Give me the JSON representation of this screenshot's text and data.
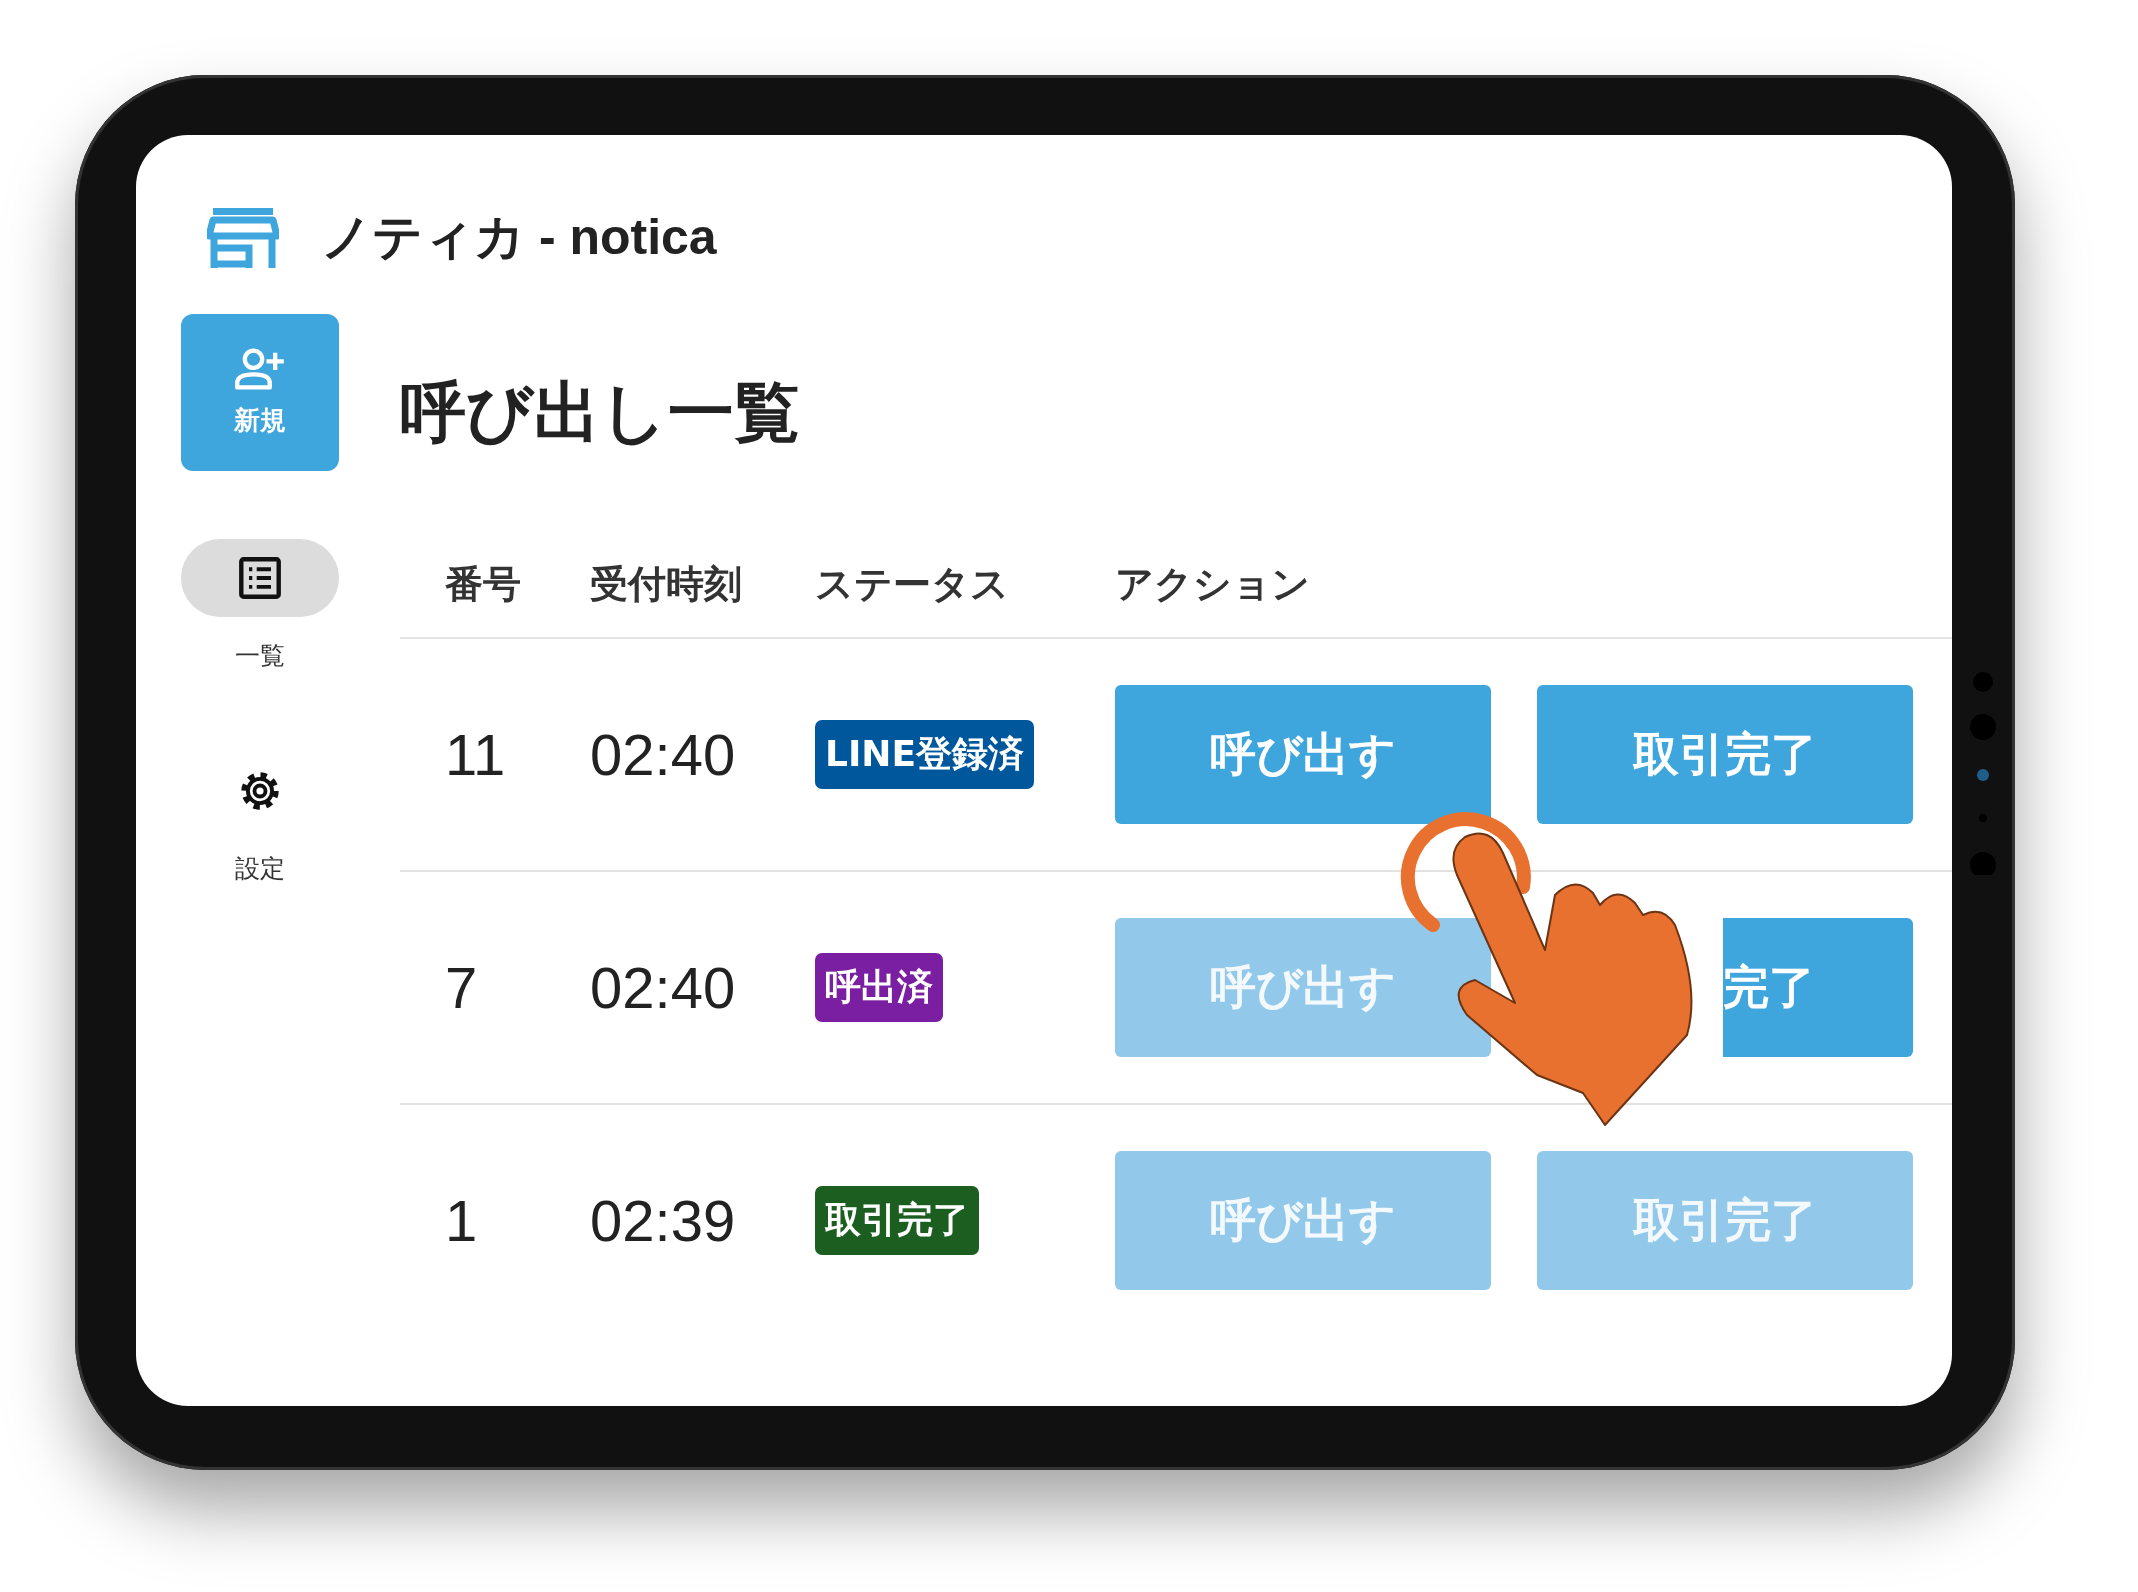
{
  "app": {
    "title": "ノティカ - notica"
  },
  "sidebar": {
    "new_button": {
      "label": "新規"
    },
    "items": [
      {
        "kind": "list",
        "label": "一覧",
        "selected": true
      },
      {
        "kind": "settings",
        "label": "設定",
        "selected": false
      }
    ]
  },
  "page_title": "呼び出し一覧",
  "table": {
    "columns": [
      "番号",
      "受付時刻",
      "ステータス",
      "アクション"
    ],
    "rows": [
      {
        "number": "11",
        "time": "02:40",
        "status": {
          "label": "LINE登録済",
          "color": "#01579b"
        },
        "actions": [
          {
            "label": "呼び出す",
            "disabled": false
          },
          {
            "label": "取引完了",
            "disabled": false
          }
        ]
      },
      {
        "number": "7",
        "time": "02:40",
        "status": {
          "label": "呼出済",
          "color": "#7b1fa2"
        },
        "actions": [
          {
            "label": "呼び出す",
            "disabled": true
          },
          {
            "label": "完了",
            "disabled": false,
            "covered": true
          }
        ]
      },
      {
        "number": "1",
        "time": "02:39",
        "status": {
          "label": "取引完了",
          "color": "#1b5e20"
        },
        "actions": [
          {
            "label": "呼び出す",
            "disabled": true
          },
          {
            "label": "取引完了",
            "disabled": true
          }
        ]
      }
    ]
  }
}
